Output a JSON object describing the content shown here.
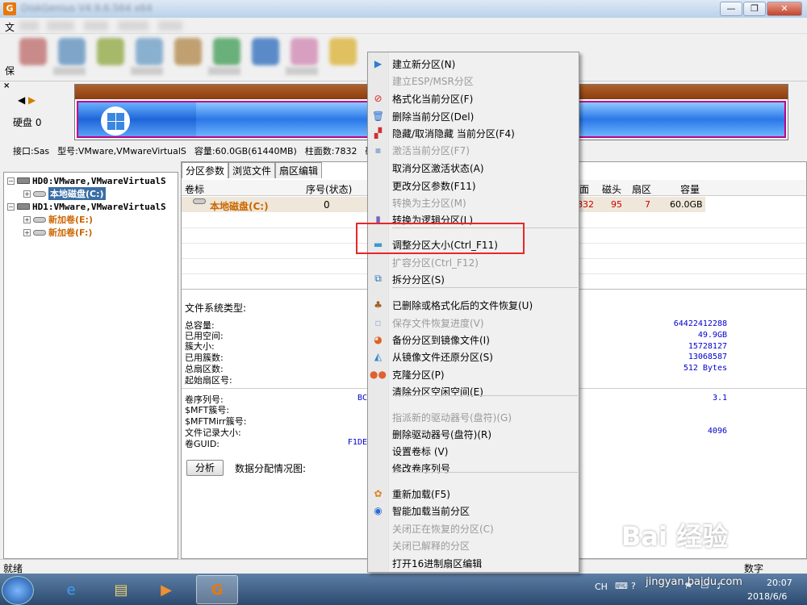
{
  "window": {
    "app_icon_letter": "G",
    "title": "DiskGenius V4.9.6.564 x64",
    "buttons": {
      "minimize": "—",
      "maximize": "❐",
      "close": "✕"
    }
  },
  "menubar": {
    "first_item": "文"
  },
  "toolbar": {
    "left_label": "保"
  },
  "disk_area": {
    "close_symbol": "×",
    "nav_left": "◀",
    "nav_right": "▶",
    "disk_label": "硬盘 0",
    "info_parts": [
      "接口:Sas",
      "型号:VMware,VMwareVirtualS",
      "容量:60.0GB(61440MB)",
      "柱面数:7832",
      "磁"
    ]
  },
  "tree": {
    "items": [
      {
        "label": "HD0:VMware,VMwareVirtualS",
        "kind": "disk"
      },
      {
        "label": "本地磁盘(C:)",
        "kind": "volume",
        "selected": true
      },
      {
        "label": "HD1:VMware,VMwareVirtualS",
        "kind": "disk"
      },
      {
        "label": "新加卷(E:)",
        "kind": "volume"
      },
      {
        "label": "新加卷(F:)",
        "kind": "volume"
      }
    ]
  },
  "tabs": [
    "分区参数",
    "浏览文件",
    "扇区编辑"
  ],
  "grid": {
    "headers": {
      "label": "卷标",
      "seq": "序号(状态)",
      "face": "面",
      "heads": "磁头",
      "sectors": "扇区",
      "capacity": "容量"
    },
    "row": {
      "label": "本地磁盘(C:)",
      "seq": "0",
      "cyl": "832",
      "heads": "95",
      "sectors": "7",
      "capacity": "60.0GB"
    }
  },
  "fsinfo": {
    "title": "文件系统类型:",
    "labels_a": [
      "总容量:",
      "已用空间:",
      "簇大小:",
      "已用簇数:",
      "总扇区数:",
      "起始扇区号:"
    ],
    "values_a": [
      "64422412288",
      "49.9GB",
      "15728127",
      "13068587",
      "512 Bytes"
    ],
    "labels_b": [
      "卷序列号:",
      "$MFT簇号:",
      "$MFTMirr簇号:",
      "文件记录大小:",
      "卷GUID:"
    ],
    "partial_b": [
      "BC",
      "F1DE"
    ],
    "values_b": [
      "3.1",
      "4096"
    ],
    "analyze_button": "分析",
    "distribution_label": "数据分配情况图:"
  },
  "statusbar": {
    "left": "就绪",
    "right": "数字"
  },
  "taskbar": {
    "tray_lang": "CH",
    "time": "20:07",
    "date": "2018/6/6"
  },
  "context_menu": {
    "items": [
      {
        "label": "建立新分区(N)",
        "enabled": true,
        "icon": "new-partition-icon",
        "glyph": "▶"
      },
      {
        "label": "建立ESP/MSR分区",
        "enabled": false,
        "icon": "none",
        "glyph": ""
      },
      {
        "label": "格式化当前分区(F)",
        "enabled": true,
        "icon": "format-icon",
        "glyph": "⊘"
      },
      {
        "label": "删除当前分区(Del)",
        "enabled": true,
        "icon": "trash-icon",
        "glyph": "🗑"
      },
      {
        "label": "隐藏/取消隐藏 当前分区(F4)",
        "enabled": true,
        "icon": "hide-icon",
        "glyph": "▞"
      },
      {
        "label": "激活当前分区(F7)",
        "enabled": false,
        "icon": "activate-icon",
        "glyph": "▪"
      },
      {
        "label": "取消分区激活状态(A)",
        "enabled": true,
        "icon": "none",
        "glyph": ""
      },
      {
        "label": "更改分区参数(F11)",
        "enabled": true,
        "icon": "none",
        "glyph": ""
      },
      {
        "label": "转换为主分区(M)",
        "enabled": false,
        "icon": "none",
        "glyph": ""
      },
      {
        "label": "转换为逻辑分区(L)",
        "enabled": true,
        "icon": "convert-icon",
        "glyph": "▮"
      },
      {
        "label": "调整分区大小(Ctrl_F11)",
        "enabled": true,
        "icon": "resize-icon",
        "glyph": "▬"
      },
      {
        "label": "扩容分区(Ctrl_F12)",
        "enabled": false,
        "icon": "none",
        "glyph": ""
      },
      {
        "label": "拆分分区(S)",
        "enabled": true,
        "icon": "split-icon",
        "glyph": "⧉"
      },
      {
        "label": "已删除或格式化后的文件恢复(U)",
        "enabled": true,
        "icon": "recover-icon",
        "glyph": "♣"
      },
      {
        "label": "保存文件恢复进度(V)",
        "enabled": false,
        "icon": "save-icon",
        "glyph": "▫"
      },
      {
        "label": "备份分区到镜像文件(I)",
        "enabled": true,
        "icon": "backup-icon",
        "glyph": "◕"
      },
      {
        "label": "从镜像文件还原分区(S)",
        "enabled": true,
        "icon": "restore-icon",
        "glyph": "◭"
      },
      {
        "label": "克隆分区(P)",
        "enabled": true,
        "icon": "clone-icon",
        "glyph": "●●"
      },
      {
        "label": "清除分区空闲空间(E)",
        "enabled": true,
        "icon": "none",
        "glyph": ""
      },
      {
        "label": "指派新的驱动器号(盘符)(G)",
        "enabled": false,
        "icon": "none",
        "glyph": ""
      },
      {
        "label": "删除驱动器号(盘符)(R)",
        "enabled": true,
        "icon": "none",
        "glyph": ""
      },
      {
        "label": "设置卷标 (V)",
        "enabled": true,
        "icon": "none",
        "glyph": ""
      },
      {
        "label": "修改卷序列号",
        "enabled": true,
        "icon": "none",
        "glyph": ""
      },
      {
        "label": "重新加载(F5)",
        "enabled": true,
        "icon": "reload-icon",
        "glyph": "✿"
      },
      {
        "label": "智能加载当前分区",
        "enabled": true,
        "icon": "smart-load-icon",
        "glyph": "◉"
      },
      {
        "label": "关闭正在恢复的分区(C)",
        "enabled": false,
        "icon": "none",
        "glyph": ""
      },
      {
        "label": "关闭已解释的分区",
        "enabled": false,
        "icon": "none",
        "glyph": ""
      },
      {
        "label": "打开16进制扇区编辑",
        "enabled": true,
        "icon": "none",
        "glyph": ""
      }
    ]
  },
  "watermark": {
    "main": "Bai 经验",
    "sub": "jingyan.baidu.com"
  },
  "colors": {
    "highlight_box": "#e8262a",
    "selected_tree": "#3a6ea5",
    "volume_orange": "#cc6600",
    "partition_border": "#c0008a"
  }
}
